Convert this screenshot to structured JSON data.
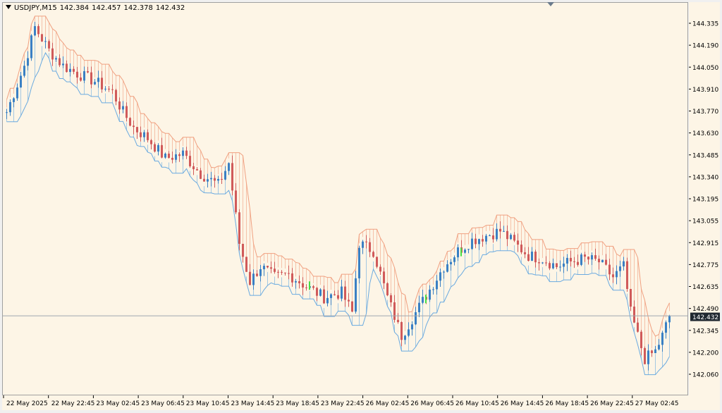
{
  "header": {
    "symbol": "USDJPY,M15",
    "open": "142.384",
    "high": "142.457",
    "low": "142.378",
    "close": "142.432"
  },
  "colors": {
    "background": "#fdf5e6",
    "bull": "#3a80c4",
    "bear": "#d05a5a",
    "upper_band": "#f0a080",
    "lower_band": "#6aaae0",
    "signal": "#44dd44",
    "price_line": "#a0a8b0"
  },
  "chart_data": {
    "type": "candlestick",
    "timeframe": "M15",
    "price_axis": {
      "min": 142.06,
      "max": 144.335,
      "ticks": [
        "144.335",
        "144.190",
        "144.050",
        "143.910",
        "143.770",
        "143.630",
        "143.485",
        "143.340",
        "143.195",
        "143.055",
        "142.915",
        "142.775",
        "142.635",
        "142.490",
        "142.345",
        "142.200",
        "142.060"
      ]
    },
    "time_axis": {
      "labels": [
        "22 May 2025",
        "22 May 22:45",
        "23 May 02:45",
        "23 May 06:45",
        "23 May 10:45",
        "23 May 14:45",
        "23 May 18:45",
        "23 May 22:45",
        "26 May 02:45",
        "26 May 06:45",
        "26 May 10:45",
        "26 May 14:45",
        "26 May 18:45",
        "26 May 22:45",
        "27 May 02:45"
      ]
    },
    "current_price": "142.432",
    "close_path": [
      [
        0,
        143.75
      ],
      [
        5,
        144.05
      ],
      [
        8,
        144.3
      ],
      [
        12,
        144.15
      ],
      [
        16,
        144.05
      ],
      [
        20,
        144.0
      ],
      [
        25,
        143.95
      ],
      [
        30,
        143.88
      ],
      [
        33,
        143.75
      ],
      [
        36,
        143.65
      ],
      [
        40,
        143.58
      ],
      [
        45,
        143.45
      ],
      [
        50,
        143.48
      ],
      [
        55,
        143.35
      ],
      [
        60,
        143.28
      ],
      [
        63,
        143.42
      ],
      [
        66,
        142.9
      ],
      [
        69,
        142.65
      ],
      [
        72,
        142.75
      ],
      [
        76,
        142.68
      ],
      [
        80,
        142.7
      ],
      [
        85,
        142.62
      ],
      [
        90,
        142.55
      ],
      [
        95,
        142.58
      ],
      [
        98,
        142.45
      ],
      [
        100,
        142.9
      ],
      [
        104,
        142.85
      ],
      [
        108,
        142.55
      ],
      [
        112,
        142.3
      ],
      [
        116,
        142.45
      ],
      [
        120,
        142.6
      ],
      [
        124,
        142.75
      ],
      [
        128,
        142.85
      ],
      [
        132,
        142.92
      ],
      [
        136,
        142.95
      ],
      [
        140,
        142.98
      ],
      [
        144,
        142.9
      ],
      [
        148,
        142.82
      ],
      [
        152,
        142.8
      ],
      [
        156,
        142.75
      ],
      [
        160,
        142.78
      ],
      [
        164,
        142.8
      ],
      [
        168,
        142.78
      ],
      [
        172,
        142.68
      ],
      [
        175,
        142.75
      ],
      [
        177,
        142.45
      ],
      [
        179,
        142.3
      ],
      [
        181,
        142.15
      ],
      [
        184,
        142.2
      ],
      [
        186,
        142.3
      ],
      [
        188,
        142.43
      ]
    ]
  }
}
